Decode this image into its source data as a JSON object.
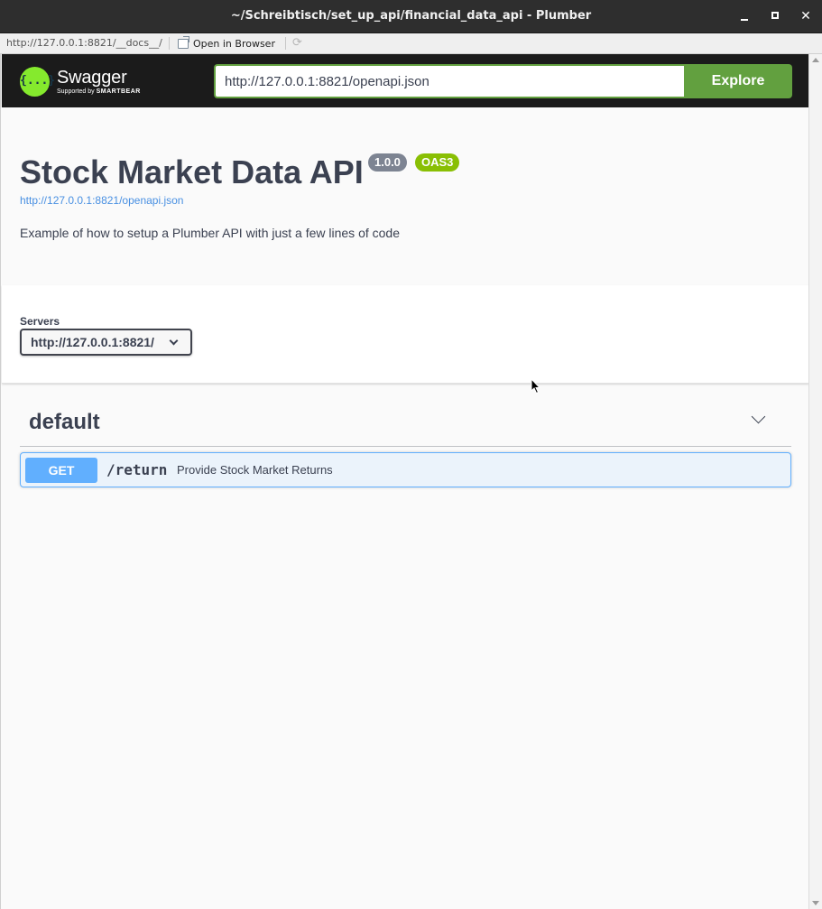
{
  "window": {
    "title": "~/Schreibtisch/set_up_api/financial_data_api - Plumber",
    "close_glyph": "✕"
  },
  "addressbar": {
    "url": "http://127.0.0.1:8821/__docs__/",
    "open_in_browser_label": "Open in Browser",
    "refresh_glyph": "⟳"
  },
  "swagger": {
    "logo_name": "Swagger",
    "logo_mark": "{...}",
    "logo_supported_prefix": "Supported by ",
    "logo_supported_brand": "SMARTBEAR",
    "spec_url_value": "http://127.0.0.1:8821/openapi.json",
    "explore_label": "Explore",
    "brand_color": "#85ea2d",
    "accent_green": "#62a03f"
  },
  "info": {
    "title": "Stock Market Data API",
    "version_badge": "1.0.0",
    "oas_badge": "OAS3",
    "spec_link": "http://127.0.0.1:8821/openapi.json",
    "description": "Example of how to setup a Plumber API with just a few lines of code"
  },
  "servers": {
    "label": "Servers",
    "selected": "http://127.0.0.1:8821/"
  },
  "operations": {
    "tag": "default",
    "items": [
      {
        "method": "GET",
        "path": "/return",
        "summary": "Provide Stock Market Returns",
        "color": "#61affe"
      }
    ]
  }
}
